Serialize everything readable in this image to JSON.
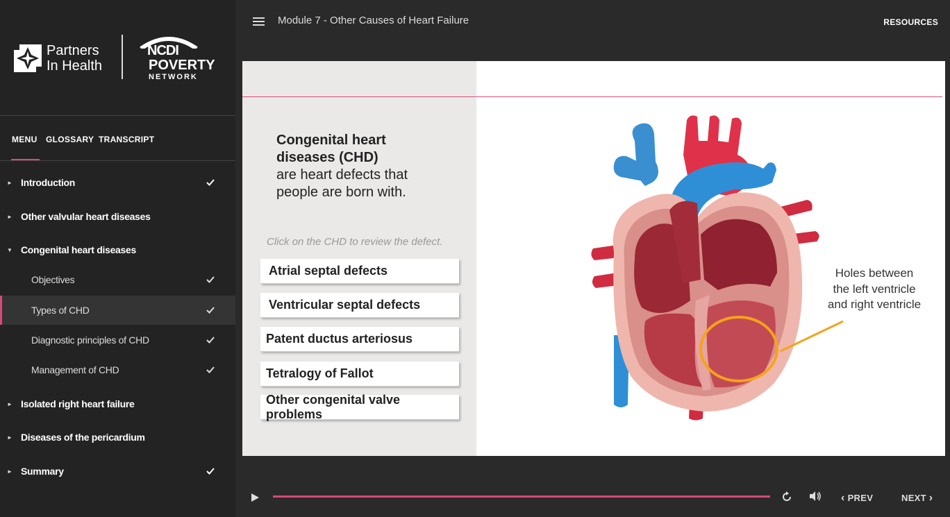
{
  "brand": {
    "pih_line1": "Partners",
    "pih_line2": "In Health",
    "ncdi_line1": "NCDI",
    "ncdi_line2": "POVERTY",
    "ncdi_line3": "NETWORK"
  },
  "header": {
    "module_title": "Module 7 - Other Causes of Heart Failure",
    "resources_label": "RESOURCES"
  },
  "sidebar": {
    "tabs": [
      "MENU",
      "GLOSSARY",
      "TRANSCRIPT"
    ],
    "items": [
      {
        "label": "Introduction",
        "completed": true
      },
      {
        "label": "Other valvular heart diseases",
        "completed": false
      },
      {
        "label": "Congenital heart diseases",
        "completed": false,
        "expanded": true
      },
      {
        "label": "Objectives",
        "completed": true
      },
      {
        "label": "Types of CHD",
        "completed": true,
        "active": true
      },
      {
        "label": "Diagnostic principles of CHD",
        "completed": true
      },
      {
        "label": "Management of CHD",
        "completed": true
      },
      {
        "label": "Isolated right heart failure",
        "completed": false
      },
      {
        "label": "Diseases of the pericardium",
        "completed": false
      },
      {
        "label": "Summary",
        "completed": true
      }
    ]
  },
  "slide": {
    "headline_bold_1": "Congenital heart",
    "headline_bold_2": "diseases (CHD)",
    "headline_rest_1": "are heart defects that",
    "headline_rest_2": "people are born with.",
    "instruction": "Click on the CHD to review the defect.",
    "buttons": [
      "Atrial septal defects",
      "Ventricular septal defects",
      "Patent ductus arteriosus",
      "Tetralogy of Fallot",
      "Other congenital valve problems"
    ],
    "callout_1": "Holes between",
    "callout_2": "the left ventricle",
    "callout_3": "and right ventricle"
  },
  "player": {
    "prev_label": "PREV",
    "next_label": "NEXT",
    "progress": 1.0
  },
  "colors": {
    "accent": "#d64a7a",
    "sidebar_bg": "#232323",
    "highlight_circle": "#f5a31a"
  }
}
